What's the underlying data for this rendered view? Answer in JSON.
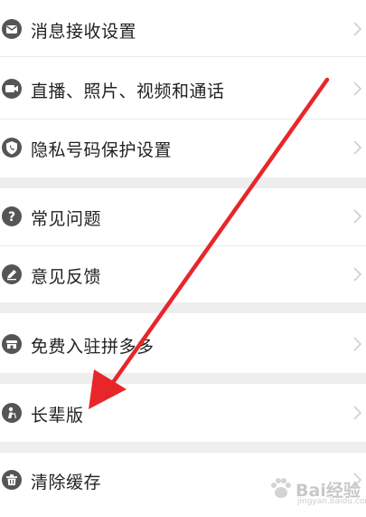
{
  "menu": {
    "items": [
      {
        "label": "消息接收设置",
        "icon": "message-icon"
      },
      {
        "label": "直播、照片、视频和通话",
        "icon": "video-camera-icon"
      },
      {
        "label": "隐私号码保护设置",
        "icon": "phone-shield-icon"
      },
      {
        "label": "常见问题",
        "icon": "question-icon"
      },
      {
        "label": "意见反馈",
        "icon": "pen-icon"
      },
      {
        "label": "免费入驻拼多多",
        "icon": "store-icon"
      },
      {
        "label": "长辈版",
        "icon": "elder-icon"
      },
      {
        "label": "清除缓存",
        "icon": "trash-icon"
      }
    ]
  },
  "watermark": {
    "brand": "Bai经验",
    "sub": "jingyan.baidu.com"
  },
  "colors": {
    "arrow": "#e8262a",
    "icon": "#555555",
    "section_gap": "#eeeeee"
  }
}
